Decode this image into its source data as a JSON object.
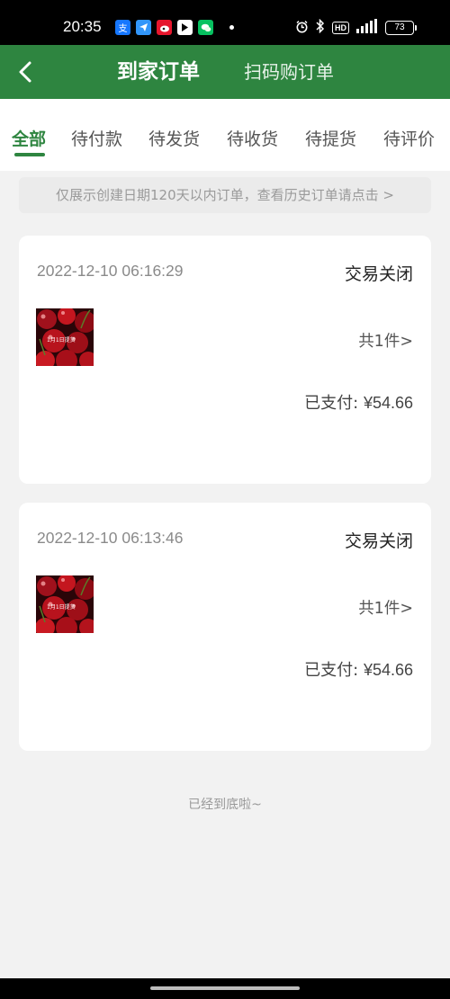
{
  "status_bar": {
    "time": "20:35",
    "battery": "73",
    "hd_label": "HD",
    "app_icons": [
      "alipay-icon",
      "dingtalk-icon",
      "weibo-icon",
      "vote-icon",
      "wechat-icon"
    ],
    "system_icons": [
      "alarm-icon",
      "bluetooth-icon",
      "hd-icon",
      "cellular-signal-icon",
      "battery-icon"
    ]
  },
  "header": {
    "back_icon": "chevron-left-icon",
    "tabs": [
      {
        "label": "到家订单",
        "active": true
      },
      {
        "label": "扫码购订单",
        "active": false
      }
    ]
  },
  "filters": {
    "tabs": [
      {
        "label": "全部",
        "active": true
      },
      {
        "label": "待付款",
        "active": false
      },
      {
        "label": "待发货",
        "active": false
      },
      {
        "label": "待收货",
        "active": false
      },
      {
        "label": "待提货",
        "active": false
      },
      {
        "label": "待评价",
        "active": false
      }
    ]
  },
  "notice": "仅展示创建日期120天以内订单，查看历史订单请点击 >",
  "orders": [
    {
      "time": "2022-12-10 06:16:29",
      "status": "交易关闭",
      "product_image": "cherries-image",
      "thumb_caption": "1月1日提货",
      "item_count": "共1件>",
      "paid_label": "已支付:",
      "paid_amount": "¥54.66"
    },
    {
      "time": "2022-12-10 06:13:46",
      "status": "交易关闭",
      "product_image": "cherries-image",
      "thumb_caption": "1月1日提货",
      "item_count": "共1件>",
      "paid_label": "已支付:",
      "paid_amount": "¥54.66"
    }
  ],
  "end_text": "已经到底啦~",
  "colors": {
    "brand_green": "#2e8540",
    "status_bar_bg": "#000000",
    "page_bg": "#f2f2f2",
    "card_bg": "#ffffff"
  }
}
